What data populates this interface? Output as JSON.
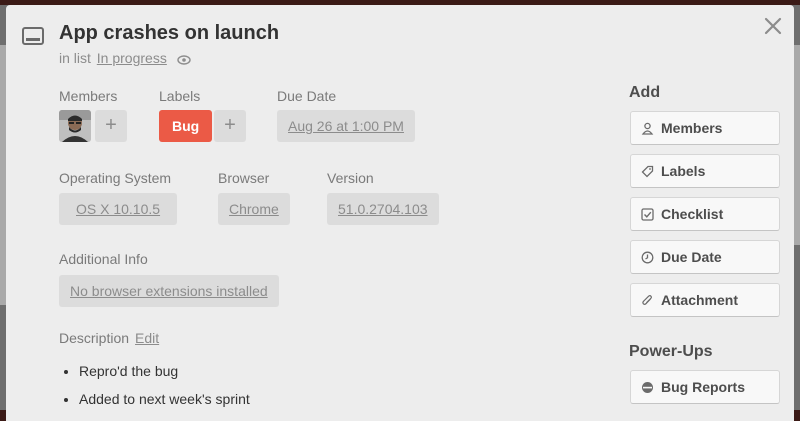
{
  "card": {
    "title": "App crashes on launch",
    "in_list_prefix": "in list",
    "list_name": "In progress"
  },
  "members": {
    "label": "Members",
    "add": "+"
  },
  "labels": {
    "label": "Labels",
    "items": [
      {
        "text": "Bug",
        "color": "#eb5a46"
      }
    ],
    "add": "+"
  },
  "due_date": {
    "label": "Due Date",
    "value": "Aug 26 at 1:00 PM"
  },
  "custom_fields": {
    "os": {
      "label": "Operating System",
      "value": "OS X 10.10.5"
    },
    "browser": {
      "label": "Browser",
      "value": "Chrome"
    },
    "version": {
      "label": "Version",
      "value": "51.0.2704.103"
    },
    "additional": {
      "label": "Additional Info",
      "value": "No browser extensions installed"
    }
  },
  "description": {
    "label": "Description",
    "edit": "Edit",
    "items": [
      "Repro'd the bug",
      "Added to next week's sprint"
    ]
  },
  "sidebar": {
    "add_heading": "Add",
    "add_buttons": [
      {
        "label": "Members",
        "icon": "person-icon"
      },
      {
        "label": "Labels",
        "icon": "tag-icon"
      },
      {
        "label": "Checklist",
        "icon": "checkbox-icon"
      },
      {
        "label": "Due Date",
        "icon": "clock-icon"
      },
      {
        "label": "Attachment",
        "icon": "paperclip-icon"
      }
    ],
    "powerups_heading": "Power-Ups",
    "powerup_buttons": [
      {
        "label": "Bug Reports",
        "icon": "bug-report-icon"
      }
    ]
  }
}
